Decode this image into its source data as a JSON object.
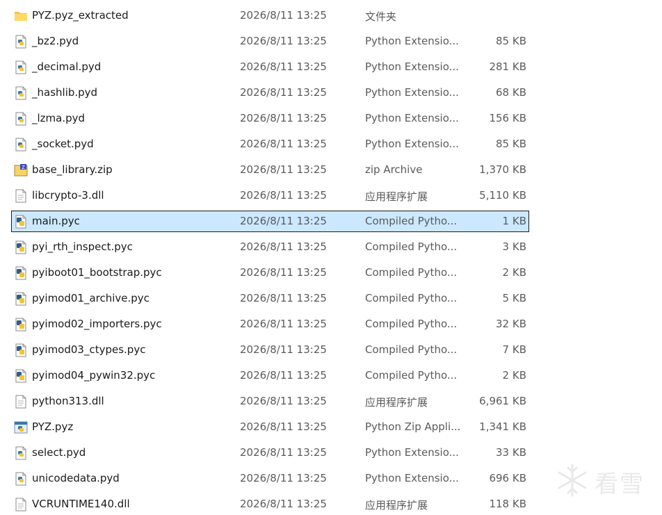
{
  "files": [
    {
      "name": "PYZ.pyz_extracted",
      "date": "2026/8/11 13:25",
      "type": "文件夹",
      "size": "",
      "icon": "folder-icon"
    },
    {
      "name": "_bz2.pyd",
      "date": "2026/8/11 13:25",
      "type": "Python Extensio...",
      "size": "85 KB",
      "icon": "python-file-icon"
    },
    {
      "name": "_decimal.pyd",
      "date": "2026/8/11 13:25",
      "type": "Python Extensio...",
      "size": "281 KB",
      "icon": "python-file-icon"
    },
    {
      "name": "_hashlib.pyd",
      "date": "2026/8/11 13:25",
      "type": "Python Extensio...",
      "size": "68 KB",
      "icon": "python-file-icon"
    },
    {
      "name": "_lzma.pyd",
      "date": "2026/8/11 13:25",
      "type": "Python Extensio...",
      "size": "156 KB",
      "icon": "python-file-icon"
    },
    {
      "name": "_socket.pyd",
      "date": "2026/8/11 13:25",
      "type": "Python Extensio...",
      "size": "85 KB",
      "icon": "python-file-icon"
    },
    {
      "name": "base_library.zip",
      "date": "2026/8/11 13:25",
      "type": "zip Archive",
      "size": "1,370 KB",
      "icon": "zip-archive-icon"
    },
    {
      "name": "libcrypto-3.dll",
      "date": "2026/8/11 13:25",
      "type": "应用程序扩展",
      "size": "5,110 KB",
      "icon": "dll-file-icon"
    },
    {
      "name": "main.pyc",
      "date": "2026/8/11 13:25",
      "type": "Compiled Pytho...",
      "size": "1 KB",
      "icon": "compiled-python-icon",
      "selected": true
    },
    {
      "name": "pyi_rth_inspect.pyc",
      "date": "2026/8/11 13:25",
      "type": "Compiled Pytho...",
      "size": "3 KB",
      "icon": "compiled-python-icon"
    },
    {
      "name": "pyiboot01_bootstrap.pyc",
      "date": "2026/8/11 13:25",
      "type": "Compiled Pytho...",
      "size": "2 KB",
      "icon": "compiled-python-icon"
    },
    {
      "name": "pyimod01_archive.pyc",
      "date": "2026/8/11 13:25",
      "type": "Compiled Pytho...",
      "size": "5 KB",
      "icon": "compiled-python-icon"
    },
    {
      "name": "pyimod02_importers.pyc",
      "date": "2026/8/11 13:25",
      "type": "Compiled Pytho...",
      "size": "32 KB",
      "icon": "compiled-python-icon"
    },
    {
      "name": "pyimod03_ctypes.pyc",
      "date": "2026/8/11 13:25",
      "type": "Compiled Pytho...",
      "size": "7 KB",
      "icon": "compiled-python-icon"
    },
    {
      "name": "pyimod04_pywin32.pyc",
      "date": "2026/8/11 13:25",
      "type": "Compiled Pytho...",
      "size": "2 KB",
      "icon": "compiled-python-icon"
    },
    {
      "name": "python313.dll",
      "date": "2026/8/11 13:25",
      "type": "应用程序扩展",
      "size": "6,961 KB",
      "icon": "dll-file-icon"
    },
    {
      "name": "PYZ.pyz",
      "date": "2026/8/11 13:25",
      "type": "Python Zip Appli...",
      "size": "1,341 KB",
      "icon": "python-zip-app-icon"
    },
    {
      "name": "select.pyd",
      "date": "2026/8/11 13:25",
      "type": "Python Extensio...",
      "size": "33 KB",
      "icon": "python-file-icon"
    },
    {
      "name": "unicodedata.pyd",
      "date": "2026/8/11 13:25",
      "type": "Python Extensio...",
      "size": "696 KB",
      "icon": "python-file-icon"
    },
    {
      "name": "VCRUNTIME140.dll",
      "date": "2026/8/11 13:25",
      "type": "应用程序扩展",
      "size": "118 KB",
      "icon": "dll-file-icon"
    }
  ],
  "watermark": {
    "text": "看雪",
    "icon": "snowflake-logo-icon"
  }
}
